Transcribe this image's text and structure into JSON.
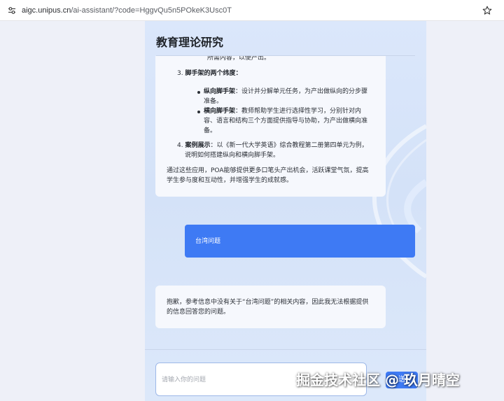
{
  "browser": {
    "url_host": "aigc.unipus.cn",
    "url_path": "/ai-assistant/?code=HggvQu5n5POkeK3Usc0T",
    "icons": {
      "site_settings": "tune-icon",
      "bookmark": "star-icon"
    }
  },
  "app": {
    "title": "教育理论研究"
  },
  "ai_response": {
    "cut_line": "所需内容，以便产出。",
    "item3_number": "3.",
    "item3_title": "脚手架的两个纬度",
    "item3_colon": "：",
    "sub1_title": "纵向脚手架",
    "sub1_text_a": "：设计并分解单元任务，为产出做纵向的分步骤",
    "sub1_text_b": "准备。",
    "sub2_title": "横向脚手架",
    "sub2_text_a": "：教师帮助学生进行选择性学习，分别针对内",
    "sub2_text_b": "容、语言和结构三个方面提供指导与协助，为产出做横向准",
    "sub2_text_c": "备。",
    "item4_number": "4.",
    "item4_title": "案例展示",
    "item4_text_a": "：以《新一代大学英语》综合教程第二册第四单元为例，",
    "item4_text_b": "说明如何搭建纵向和横向脚手架。",
    "summary_a": "通过这些应用，POA能够提供更多口笔头产出机会，活跃课堂气氛，提高",
    "summary_b": "学生参与度和互动性，并增强学生的成就感。"
  },
  "user_message": {
    "text": "台湾问题"
  },
  "ai_reply": {
    "line_a": "抱歉，参考信息中没有关于“台湾问题”的相关内容，因此我无法根据提供",
    "line_b": "的信息回答您的问题。"
  },
  "composer": {
    "placeholder": "请输入你的问题",
    "send_label": "送"
  },
  "watermark": {
    "text": "掘金技术社区 @ 玖月晴空"
  },
  "colors": {
    "accent": "#3e7af4",
    "app_bg": "#d4e2f8",
    "card_bg": "#f6f8fd"
  }
}
